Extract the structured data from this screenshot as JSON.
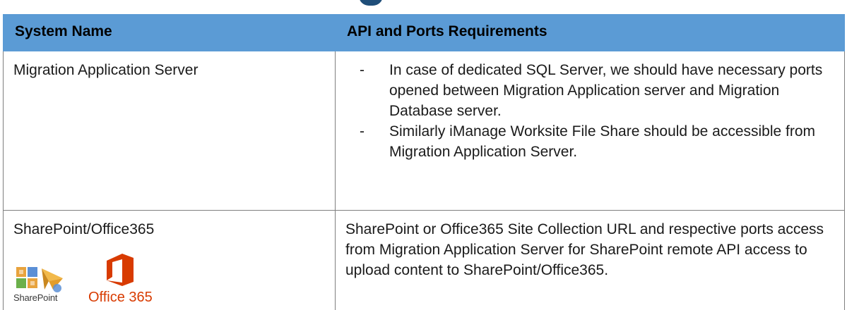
{
  "table": {
    "headers": [
      "System Name",
      "API and Ports Requirements"
    ],
    "rows": [
      {
        "system": "Migration Application Server",
        "requirements": [
          "In case of dedicated SQL Server, we should have necessary ports opened between Migration Application server and Migration Database server.",
          "Similarly iManage Worksite File Share should be accessible from Migration Application Server."
        ]
      },
      {
        "system": "SharePoint/Office365",
        "requirement_text": "SharePoint or Office365 Site Collection URL and respective ports access from Migration Application Server for SharePoint remote API access to upload content to SharePoint/Office365.",
        "logos": {
          "sharepoint": {
            "text": "SharePoint",
            "icon": "sharepoint-logo"
          },
          "office365": {
            "text": "Office 365",
            "icon": "office365-logo"
          }
        }
      }
    ]
  },
  "list_marker": "-",
  "colors": {
    "header_bg": "#5b9bd5",
    "border": "#7f7f7f",
    "office_orange": "#d83b01",
    "heading_blue": "#1f4e79"
  }
}
